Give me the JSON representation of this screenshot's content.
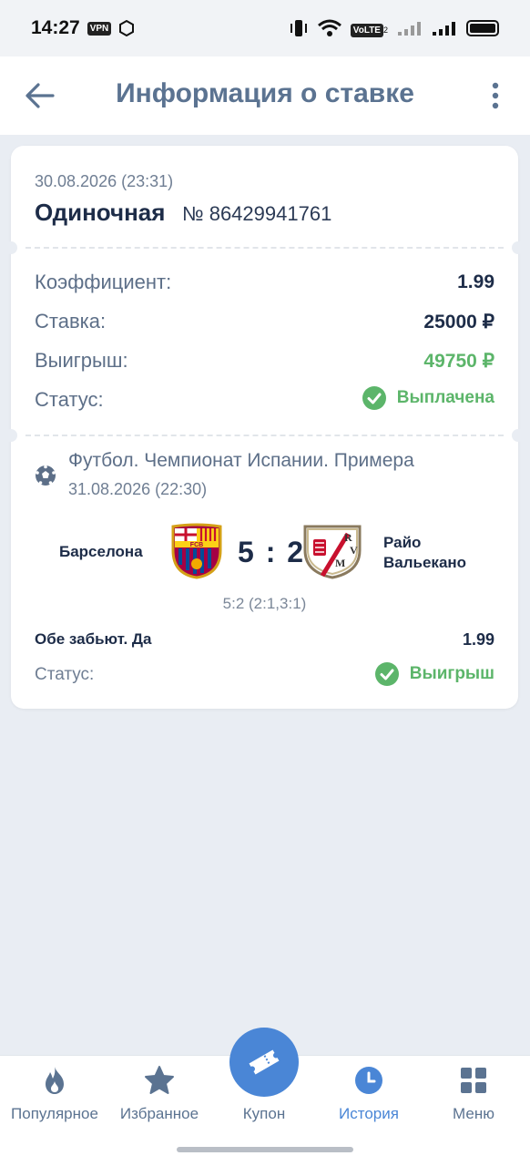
{
  "status_bar": {
    "time": "14:27",
    "vpn": "VPN",
    "volte": "VoLTE",
    "volte_sub": "2"
  },
  "header": {
    "title": "Информация о ставке",
    "icons": [
      "arrow-back-icon",
      "more-vertical-icon"
    ]
  },
  "bet": {
    "date": "30.08.2026 (23:31)",
    "type": "Одиночная",
    "number": "№ 86429941761",
    "rows": {
      "coef_label": "Коэффициент:",
      "coef_value": "1.99",
      "stake_label": "Ставка:",
      "stake_value": "25000 ₽",
      "win_label": "Выигрыш:",
      "win_value": "49750 ₽",
      "status_label": "Статус:",
      "status_value": "Выплачена"
    }
  },
  "event": {
    "league": "Футбол. Чемпионат Испании. Примера",
    "date": "31.08.2026 (22:30)",
    "team1": "Барселона",
    "team1_crest_text": "FCB",
    "score": "5 : 2",
    "team2": "Райо Вальекано",
    "team2_crest_text": "RVM",
    "score_detail": "5:2 (2:1,3:1)",
    "market": "Обе забьют. Да",
    "market_odd": "1.99",
    "status_label": "Статус:",
    "status_value": "Выигрыш"
  },
  "colors": {
    "accent": "#4a86d6",
    "title": "#5b7391",
    "success": "#5cb56a",
    "dark_text": "#1d2c48"
  },
  "bottom_nav": {
    "items": [
      {
        "label": "Популярное",
        "icon": "flame-icon"
      },
      {
        "label": "Избранное",
        "icon": "star-icon"
      },
      {
        "label": "Купон",
        "icon": "ticket-icon"
      },
      {
        "label": "История",
        "icon": "clock-icon"
      },
      {
        "label": "Меню",
        "icon": "grid-icon"
      }
    ]
  }
}
